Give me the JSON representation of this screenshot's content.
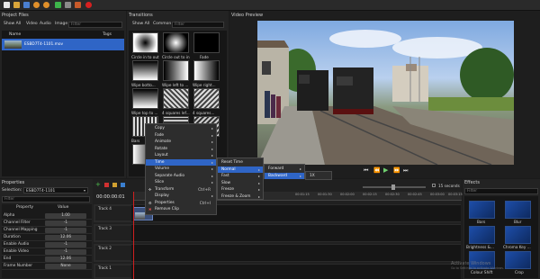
{
  "toolbar": {
    "icons": [
      "new-icon",
      "open-icon",
      "save-icon",
      "undo-icon",
      "redo-icon",
      "import-icon",
      "profile-icon",
      "export-icon",
      "record-icon"
    ]
  },
  "project_files": {
    "title": "Project Files",
    "tabs": [
      "Show All",
      "Video",
      "Audio",
      "Image"
    ],
    "filter_placeholder": "Filter",
    "columns": [
      "Name",
      "Tags"
    ],
    "file": {
      "name": "ESBD7T4-1101.mov"
    }
  },
  "transitions": {
    "title": "Transitions",
    "tabs": [
      "Show All",
      "Common"
    ],
    "filter_placeholder": "Filter",
    "items": [
      {
        "label": "Circle in to out"
      },
      {
        "label": "Circle out to in"
      },
      {
        "label": "Fade"
      },
      {
        "label": "Wipe botto..."
      },
      {
        "label": "Wipe left to ..."
      },
      {
        "label": "Wipe right..."
      },
      {
        "label": "Wipe top to ..."
      },
      {
        "label": "4 squares lef..."
      },
      {
        "label": "4 squares..."
      },
      {
        "label": "Bars"
      },
      {
        "label": ""
      },
      {
        "label": ""
      }
    ]
  },
  "preview": {
    "title": "Video Preview"
  },
  "context_menu": {
    "items": [
      {
        "label": "Copy",
        "arrow": "▸"
      },
      {
        "label": "Fade",
        "arrow": "▸"
      },
      {
        "label": "Animate",
        "arrow": "▸"
      },
      {
        "label": "Rotate",
        "arrow": "▸"
      },
      {
        "label": "Layout",
        "arrow": "▸"
      },
      {
        "label": "Time",
        "arrow": "▸"
      },
      {
        "label": "Volume",
        "arrow": "▸"
      },
      {
        "label": "Separate Audio",
        "arrow": "▸"
      },
      {
        "label": "Slice",
        "arrow": "▸"
      },
      {
        "label": "Transform",
        "shortcut": "Ctrl+R"
      },
      {
        "label": "Display",
        "arrow": "▸"
      },
      {
        "label": "Properties",
        "shortcut": "Ctrl+I"
      },
      {
        "label": "Remove Clip"
      }
    ],
    "time_submenu": [
      "Reset Time",
      "Normal",
      "Fast",
      "Slow",
      "Freeze",
      "Freeze & Zoom"
    ],
    "normal_submenu": [
      "Forward",
      "Backward"
    ],
    "speed_submenu": [
      "1X"
    ]
  },
  "properties": {
    "title": "Properties",
    "selection_label": "Selection:",
    "selection_value": "ESBD7T4-1101",
    "filter_placeholder": "Filter",
    "columns": [
      "Property",
      "Value"
    ],
    "rows": [
      {
        "k": "Alpha",
        "v": "1.00"
      },
      {
        "k": "Channel Filter",
        "v": "-1"
      },
      {
        "k": "Channel Mapping",
        "v": "-1"
      },
      {
        "k": "Duration",
        "v": "12.06"
      },
      {
        "k": "Enable Audio",
        "v": "-1"
      },
      {
        "k": "Enable Video",
        "v": "-1"
      },
      {
        "k": "End",
        "v": "12.06"
      },
      {
        "k": "Frame Number",
        "v": "None"
      }
    ]
  },
  "timeline": {
    "timecode": "00:00:00:01",
    "zoom_label": "15 seconds",
    "ruler": [
      "00:01:15",
      "00:01:30",
      "00:02:00",
      "00:02:15",
      "00:02:30",
      "00:02:45",
      "00:03:00",
      "00:03:15",
      "00:03:30"
    ],
    "tracks": [
      "Track 4",
      "Track 3",
      "Track 2",
      "Track 1"
    ]
  },
  "effects": {
    "title": "Effects",
    "filter_placeholder": "Filter",
    "items": [
      {
        "label": "Bars"
      },
      {
        "label": "Blur"
      },
      {
        "label": "Brightness &..."
      },
      {
        "label": "Chroma Key ..."
      },
      {
        "label": "Colour Shift"
      },
      {
        "label": "Crop"
      }
    ]
  },
  "watermark": {
    "line1": "Activate Windows",
    "line2": "Go to Settings to activate Windows."
  }
}
